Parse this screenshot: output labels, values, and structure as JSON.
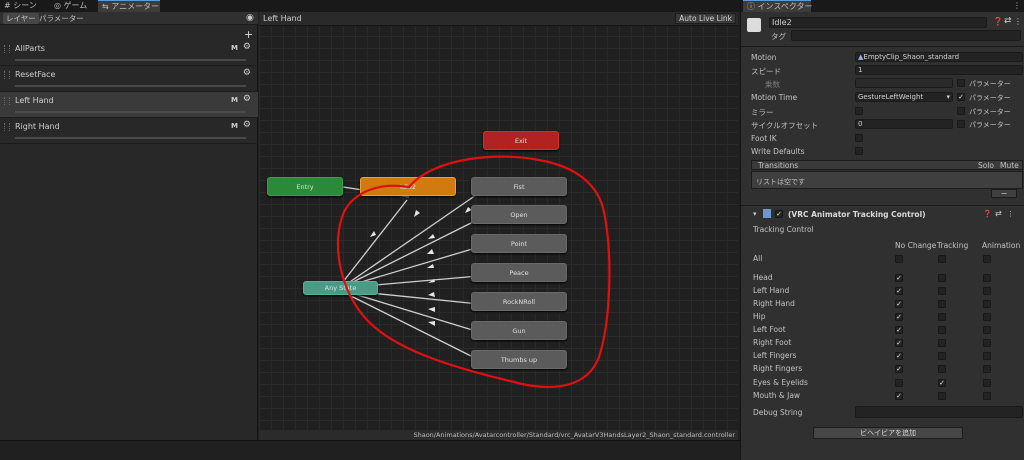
{
  "top_tabs": [
    {
      "icon": "#",
      "label": "シーン"
    },
    {
      "icon": "◎",
      "label": "ゲーム"
    },
    {
      "icon": "⇆",
      "label": "アニメーター"
    }
  ],
  "sub_tabs": [
    "レイヤー",
    "パラメーター"
  ],
  "add_symbol": "+",
  "layers": [
    {
      "name": "AllParts",
      "m": "M"
    },
    {
      "name": "ResetFace",
      "m": ""
    },
    {
      "name": "Left Hand",
      "m": "M"
    },
    {
      "name": "Right Hand",
      "m": "M"
    }
  ],
  "graph": {
    "breadcrumb": "Left Hand",
    "auto_live_link": "Auto Live Link",
    "path": "Shaon/Animations/Avatarcontroller/Standard/vrc_AvatarV3HandsLayer2_Shaon_standard.controller",
    "nodes": {
      "exit": "Exit",
      "entry": "Entry",
      "idle": "Idle2",
      "any": "Any State",
      "fist": "Fist",
      "open": "Open",
      "point": "Point",
      "peace": "Peace",
      "rock": "RockNRoll",
      "gun": "Gun",
      "thumbs": "Thumbs up"
    }
  },
  "inspector": {
    "tab": "インスペクター",
    "name": "Idle2",
    "tag": "タグ",
    "rows": {
      "motion": "Motion",
      "motion_val": "EmptyClip_Shaon_standard",
      "speed": "スピード",
      "speed_val": "1",
      "multiplier": "乗数",
      "param": "パラメーター",
      "motion_time": "Motion Time",
      "motion_time_val": "GestureLeftWeight",
      "mirror": "ミラー",
      "cycle": "サイクルオフセット",
      "cycle_val": "0",
      "foot_ik": "Foot IK",
      "write_defaults": "Write Defaults"
    },
    "transitions": {
      "title": "Transitions",
      "solo": "Solo",
      "mute": "Mute",
      "empty": "リストは空です",
      "minus": "−"
    },
    "component": "(VRC Animator Tracking Control)",
    "tracking": {
      "label": "Tracking Control",
      "headers": [
        "No Change",
        "Tracking",
        "Animation"
      ],
      "rows": [
        {
          "name": "All",
          "nc": false,
          "tr": false
        },
        {
          "name": "Head",
          "nc": true,
          "tr": false
        },
        {
          "name": "Left Hand",
          "nc": true,
          "tr": false
        },
        {
          "name": "Right Hand",
          "nc": true,
          "tr": false
        },
        {
          "name": "Hip",
          "nc": true,
          "tr": false
        },
        {
          "name": "Left Foot",
          "nc": true,
          "tr": false
        },
        {
          "name": "Right Foot",
          "nc": true,
          "tr": false
        },
        {
          "name": "Left Fingers",
          "nc": true,
          "tr": false
        },
        {
          "name": "Right Fingers",
          "nc": true,
          "tr": false
        },
        {
          "name": "Eyes & Eyelids",
          "nc": false,
          "tr": true
        },
        {
          "name": "Mouth & Jaw",
          "nc": true,
          "tr": false
        }
      ]
    },
    "debug": "Debug String",
    "add_behaviour": "ビヘイビアを追加"
  },
  "colors": {
    "exit": "#b02020",
    "entry": "#2a8a3a",
    "idle": "#d07a10",
    "any": "#4a9a86",
    "annotation": "#e01010"
  }
}
